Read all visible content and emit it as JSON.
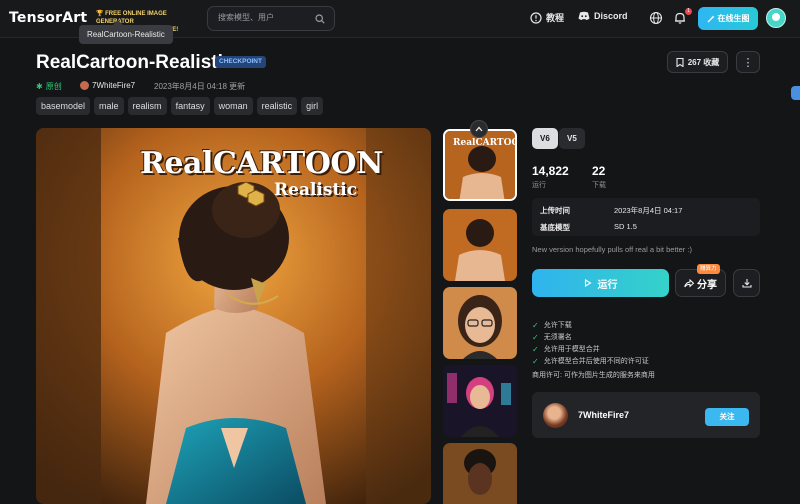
{
  "header": {
    "logo": "TensorArt",
    "promo_line1": "🏆 FREE ONLINE IMAGE GENERATOR",
    "promo_line2": "AND MODEL HOSTING SITE!",
    "search_placeholder": "搜索模型、用户",
    "nav_tutorial": "教程",
    "nav_discord": "Discord",
    "notification_count": "1",
    "create_button": "在线生图"
  },
  "tooltip": "RealCartoon-Realistic",
  "model": {
    "title": "RealCartoon-Realistic",
    "type_badge": "CHECKPOINT",
    "original_label": "原创",
    "author": "7WhiteFire7",
    "updated": "2023年8月4日 04:18 更新",
    "save_label": "267 收藏",
    "tags": [
      "basemodel",
      "male",
      "realism",
      "fantasy",
      "woman",
      "realistic",
      "girl"
    ]
  },
  "hero": {
    "title": "RealCARTOON",
    "subtitle": "Realistic"
  },
  "versions": [
    "V6",
    "V5"
  ],
  "stats": {
    "runs_value": "14,822",
    "runs_label": "运行",
    "downloads_value": "22",
    "downloads_label": "下载"
  },
  "info": {
    "upload_key": "上传时间",
    "upload_value": "2023年8月4日 04:17",
    "base_key": "基底模型",
    "base_value": "SD 1.5"
  },
  "description": "New version hopefully pulls off real a bit better :)",
  "actions": {
    "run": "运行",
    "share": "分享",
    "share_badge": "赚算力"
  },
  "permissions": [
    "允许下载",
    "无须署名",
    "允许用于模型合并",
    "允许模型合并后使用不同的许可证"
  ],
  "commercial": "商用许可: 可作为图片生成的服务来商用",
  "author_card": {
    "name": "7WhiteFire7",
    "follow": "关注"
  },
  "colors": {
    "background": "#141517",
    "accent": "#2fb6f2",
    "badge": "#24457a",
    "success": "#34c77b"
  }
}
